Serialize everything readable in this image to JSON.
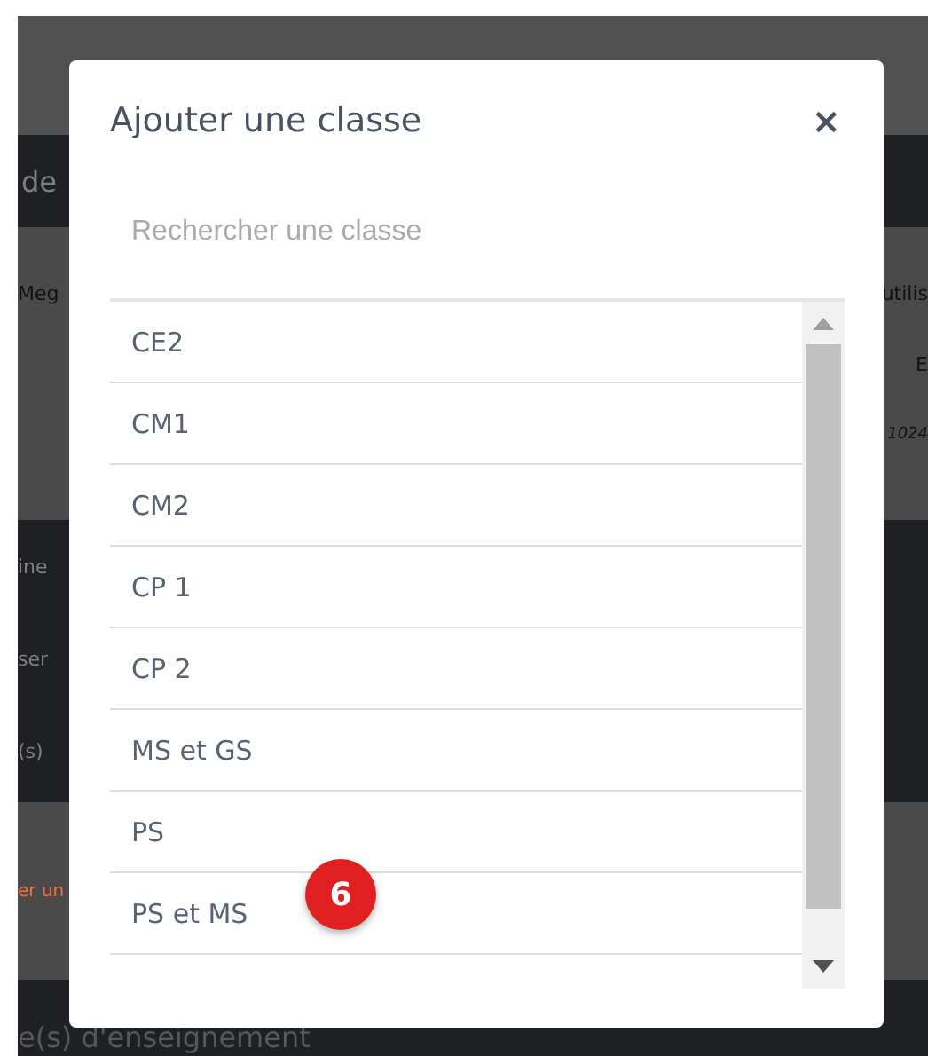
{
  "background_page": {
    "sections": [
      {
        "left": [
          {
            "text": "de",
            "kind": "heading"
          }
        ]
      },
      {
        "left": [
          {
            "text": "Meg",
            "kind": "text"
          }
        ],
        "right": [
          {
            "text": "utilis",
            "kind": "text"
          },
          {
            "text": "E",
            "kind": "text"
          },
          {
            "text": "1024",
            "kind": "note"
          }
        ]
      },
      {
        "left": [
          {
            "text": "ine",
            "kind": "heading"
          },
          {
            "text": "ser",
            "kind": "heading"
          },
          {
            "text": "(s)",
            "kind": "heading"
          }
        ]
      },
      {
        "left": [
          {
            "text": "er un",
            "kind": "link"
          }
        ]
      },
      {
        "left": [
          {
            "text": "e(s) d'enseignement",
            "kind": "heading"
          }
        ]
      }
    ]
  },
  "dialog": {
    "title": "Ajouter une classe",
    "close": "×",
    "search": {
      "placeholder": "Rechercher une classe"
    },
    "items": [
      {
        "label": "CE2"
      },
      {
        "label": "CM1"
      },
      {
        "label": "CM2"
      },
      {
        "label": "CP 1"
      },
      {
        "label": "CP 2"
      },
      {
        "label": "MS et GS"
      },
      {
        "label": "PS"
      },
      {
        "label": "PS et MS"
      }
    ],
    "badge": "6"
  }
}
